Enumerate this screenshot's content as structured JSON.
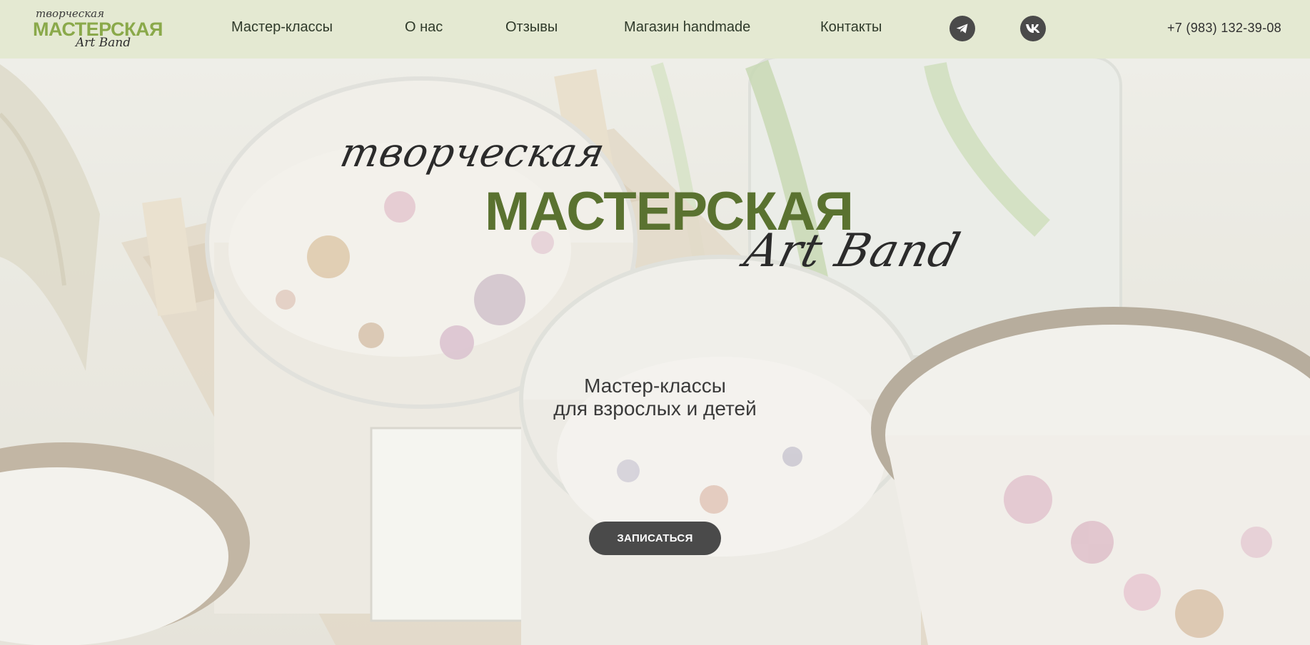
{
  "logo": {
    "line1": "творческая",
    "line2": "МАСТЕРСКАЯ",
    "line3": "Art Band"
  },
  "nav": {
    "items": [
      {
        "label": "Мастер-классы"
      },
      {
        "label": "О нас"
      },
      {
        "label": "Отзывы"
      },
      {
        "label": "Магазин handmade"
      },
      {
        "label": "Контакты"
      }
    ],
    "social": [
      {
        "icon": "telegram-icon"
      },
      {
        "icon": "vk-icon"
      }
    ],
    "phone": "+7 (983) 132-39-08"
  },
  "hero": {
    "title_top": "творческая",
    "title_main": "МАСТЕРСКАЯ",
    "title_bottom": "Art Band",
    "tagline_1": "Мастер-классы",
    "tagline_2": "для взрослых и детей",
    "cta_label": "ЗАПИСАТЬСЯ"
  },
  "colors": {
    "nav_bg": "#e4e9d2",
    "accent_green": "#5a7230",
    "logo_green": "#8aa94a",
    "button_bg": "#4a4a4a"
  }
}
